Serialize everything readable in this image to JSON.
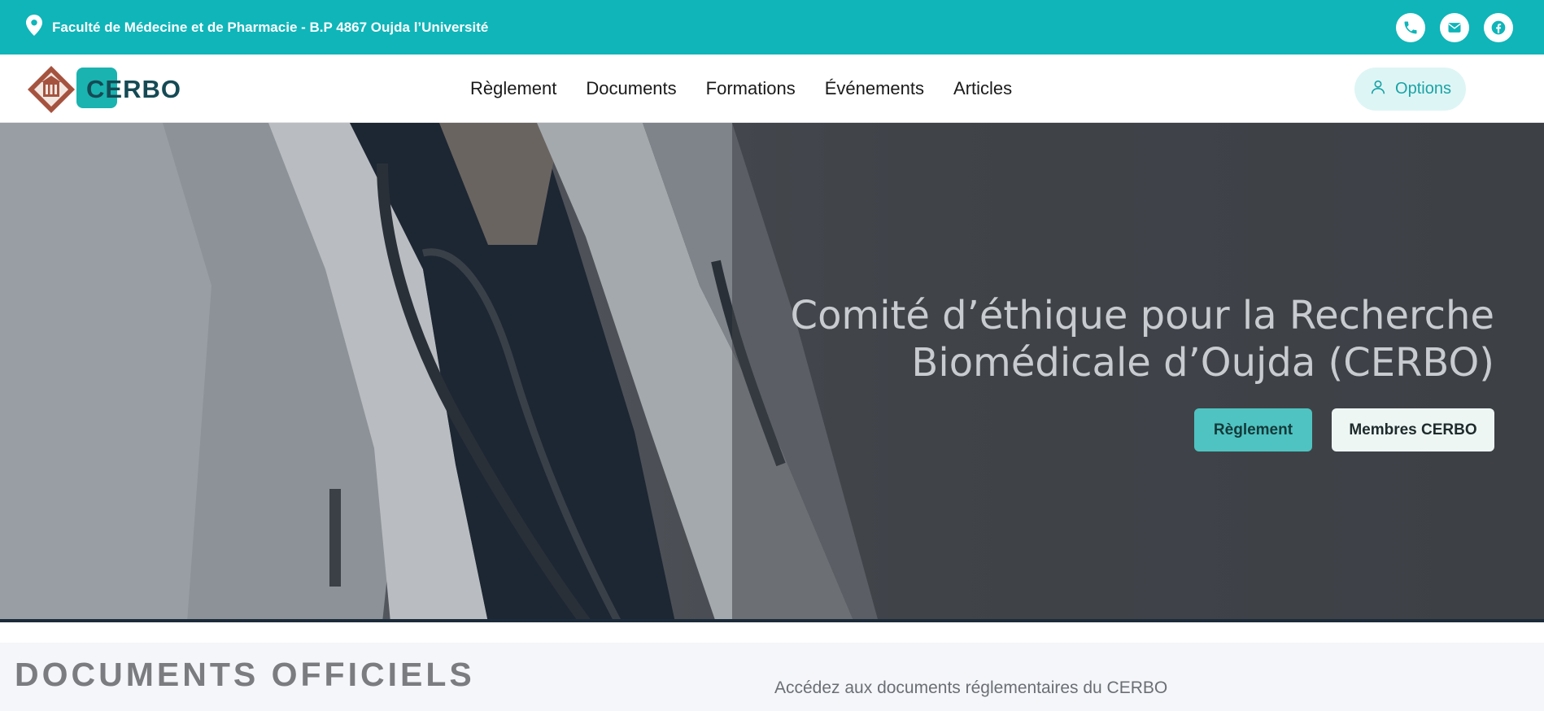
{
  "topbar": {
    "address": "Faculté de Médecine et de Pharmacie - B.P 4867 Oujda l’Université",
    "socials": [
      "phone-icon",
      "mail-icon",
      "facebook-icon"
    ]
  },
  "nav": {
    "logo_text": "CERBO",
    "items": [
      "Règlement",
      "Documents",
      "Formations",
      "Événements",
      "Articles"
    ],
    "options_label": "Options"
  },
  "hero": {
    "title_line1": "Comité d’éthique pour la Recherche",
    "title_line2": "Biomédicale d’Oujda (CERBO)",
    "primary_button": "Règlement",
    "secondary_button": "Membres CERBO"
  },
  "documents": {
    "title": "DOCUMENTS OFFICIELS",
    "subtitle": "Accédez aux documents réglementaires du CERBO"
  },
  "colors": {
    "accent": "#0fb5b9",
    "primary_button": "#4fc3c1"
  }
}
